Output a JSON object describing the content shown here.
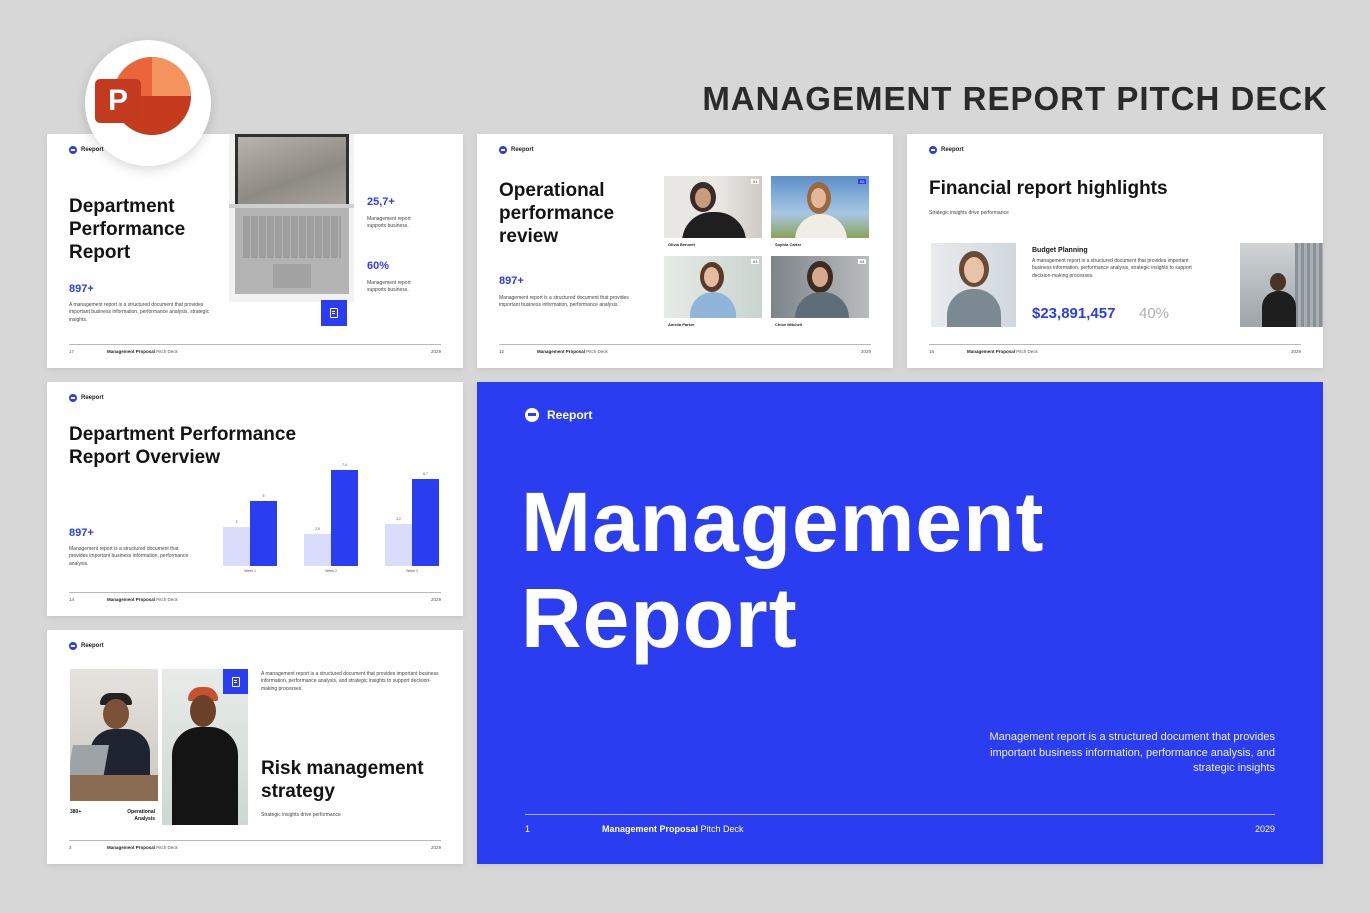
{
  "header": {
    "title": "MANAGEMENT REPORT PITCH DECK",
    "app_icon": "powerpoint-icon",
    "app_letter": "P"
  },
  "brand": {
    "name": "Reeport",
    "accent": "#2a3df0"
  },
  "slides": {
    "s1": {
      "logo": "Reeport",
      "title": "Department Performance Report",
      "stat_a": "25,7+",
      "text_a": "Management report supports business.",
      "stat_b": "60%",
      "text_b": "Management report supports business.",
      "stat_c": "897+",
      "desc": "A management report is a structured document that provides important business information, performance analysis, strategic insights.",
      "page": "17",
      "footer_bold": "Management Proposal",
      "footer_rest": "Pitch Deck",
      "year": "2029"
    },
    "s2": {
      "logo": "Reeport",
      "title": "Operational performance review",
      "stat": "897+",
      "desc": "Management report is a structured document that provides important business information, performance analysis.",
      "people": [
        {
          "num": "01",
          "name": "Olivia Bennett"
        },
        {
          "num": "02",
          "name": "Sophia Carter"
        },
        {
          "num": "03",
          "name": "Amelia Parker"
        },
        {
          "num": "04",
          "name": "Chloe Mitchell"
        }
      ],
      "page": "12",
      "footer_bold": "Management Proposal",
      "footer_rest": "Pitch Deck",
      "year": "2029"
    },
    "s3": {
      "logo": "Reeport",
      "title": "Financial report highlights",
      "subtitle": "Strategic insights drive performance",
      "card_title": "Budget Planning",
      "card_desc": "A management report is a structured document that provides important business information, performance analysis, strategic insights to support decision-making processes.",
      "amount": "$23,891,457",
      "percent": "40%",
      "page": "16",
      "footer_bold": "Management Proposal",
      "footer_rest": "Pitch Deck",
      "year": "2029"
    },
    "s4": {
      "logo": "Reeport",
      "title": "Department Performance Report Overview",
      "stat": "897+",
      "desc": "Management report is a structured document that provides important business information, performance analysis.",
      "page": "14",
      "footer_bold": "Management Proposal",
      "footer_rest": "Pitch Deck",
      "year": "2029"
    },
    "s5": {
      "logo": "Reeport",
      "desc": "A management report is a structured document that provides important business information, performance analysis, and strategic insights to support decision-making processes.",
      "title": "Risk management strategy",
      "subtitle": "Strategic insights drive performance",
      "stat": "380+",
      "stat_label": "Operational Analysis",
      "page": "3",
      "footer_bold": "Management Proposal",
      "footer_rest": "Pitch Deck",
      "year": "2029"
    },
    "hero": {
      "logo": "Reeport",
      "title_line1": "Management",
      "title_line2": "Report",
      "desc": "Management report is a structured document that provides important business information, performance analysis, and strategic insights",
      "page": "1",
      "footer_bold": "Management Proposal",
      "footer_rest": "Pitch Deck",
      "year": "2029"
    }
  },
  "chart_data": {
    "type": "bar",
    "categories": [
      "Week 1",
      "Week 2",
      "Week 3"
    ],
    "series": [
      {
        "values": [
          3,
          2.5,
          3.2
        ],
        "labels": [
          "3",
          "2,5",
          "3,2"
        ],
        "color": "#d9dcfb"
      },
      {
        "values": [
          5,
          7.4,
          6.7
        ],
        "labels": [
          "5",
          "7,4",
          "6,7"
        ],
        "color": "#2a3df0"
      }
    ],
    "ylim": [
      0,
      8
    ]
  }
}
